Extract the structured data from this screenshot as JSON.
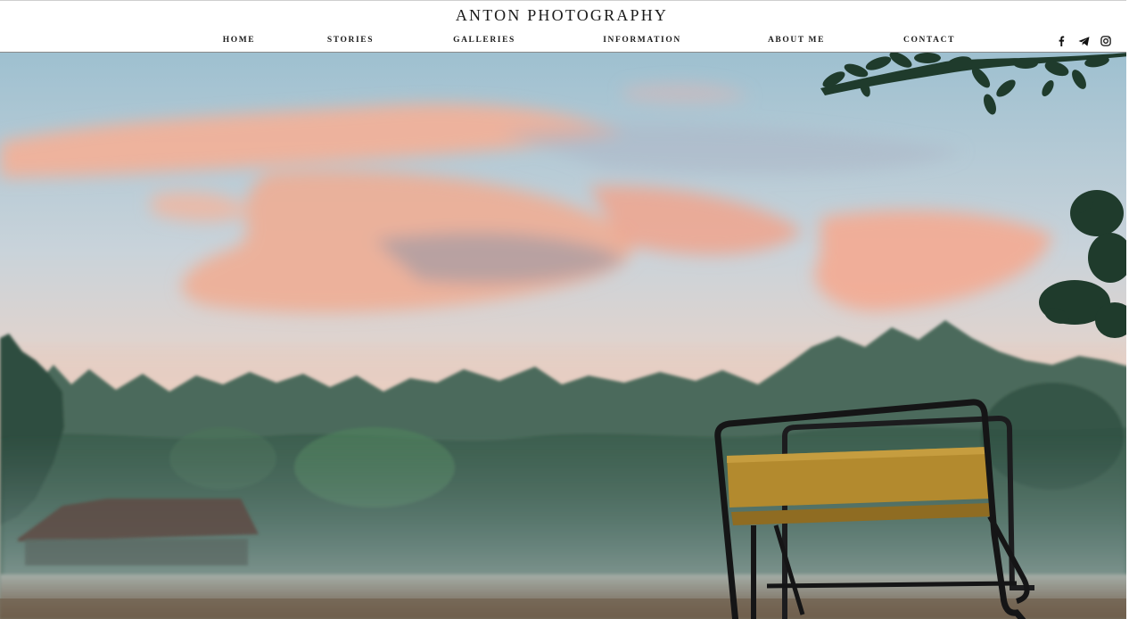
{
  "site": {
    "title": "ANTON PHOTOGRAPHY"
  },
  "nav": {
    "items": [
      {
        "label": "HOME"
      },
      {
        "label": "STORIES"
      },
      {
        "label": "GALLERIES"
      },
      {
        "label": "INFORMATION"
      },
      {
        "label": "ABOUT ME"
      },
      {
        "label": "CONTACT"
      }
    ]
  },
  "social": [
    {
      "icon": "facebook-icon"
    },
    {
      "icon": "telegram-icon"
    },
    {
      "icon": "instagram-icon"
    }
  ],
  "hero": {
    "image": "sunrise-misty-forest-bench-photo"
  },
  "colors": {
    "header_bg": "#ffffff",
    "nav_text": "#1b1b1b",
    "sky_top": "#8fb6c9",
    "cloud_pink": "#f3a98f",
    "forest": "#3c5a4a"
  }
}
